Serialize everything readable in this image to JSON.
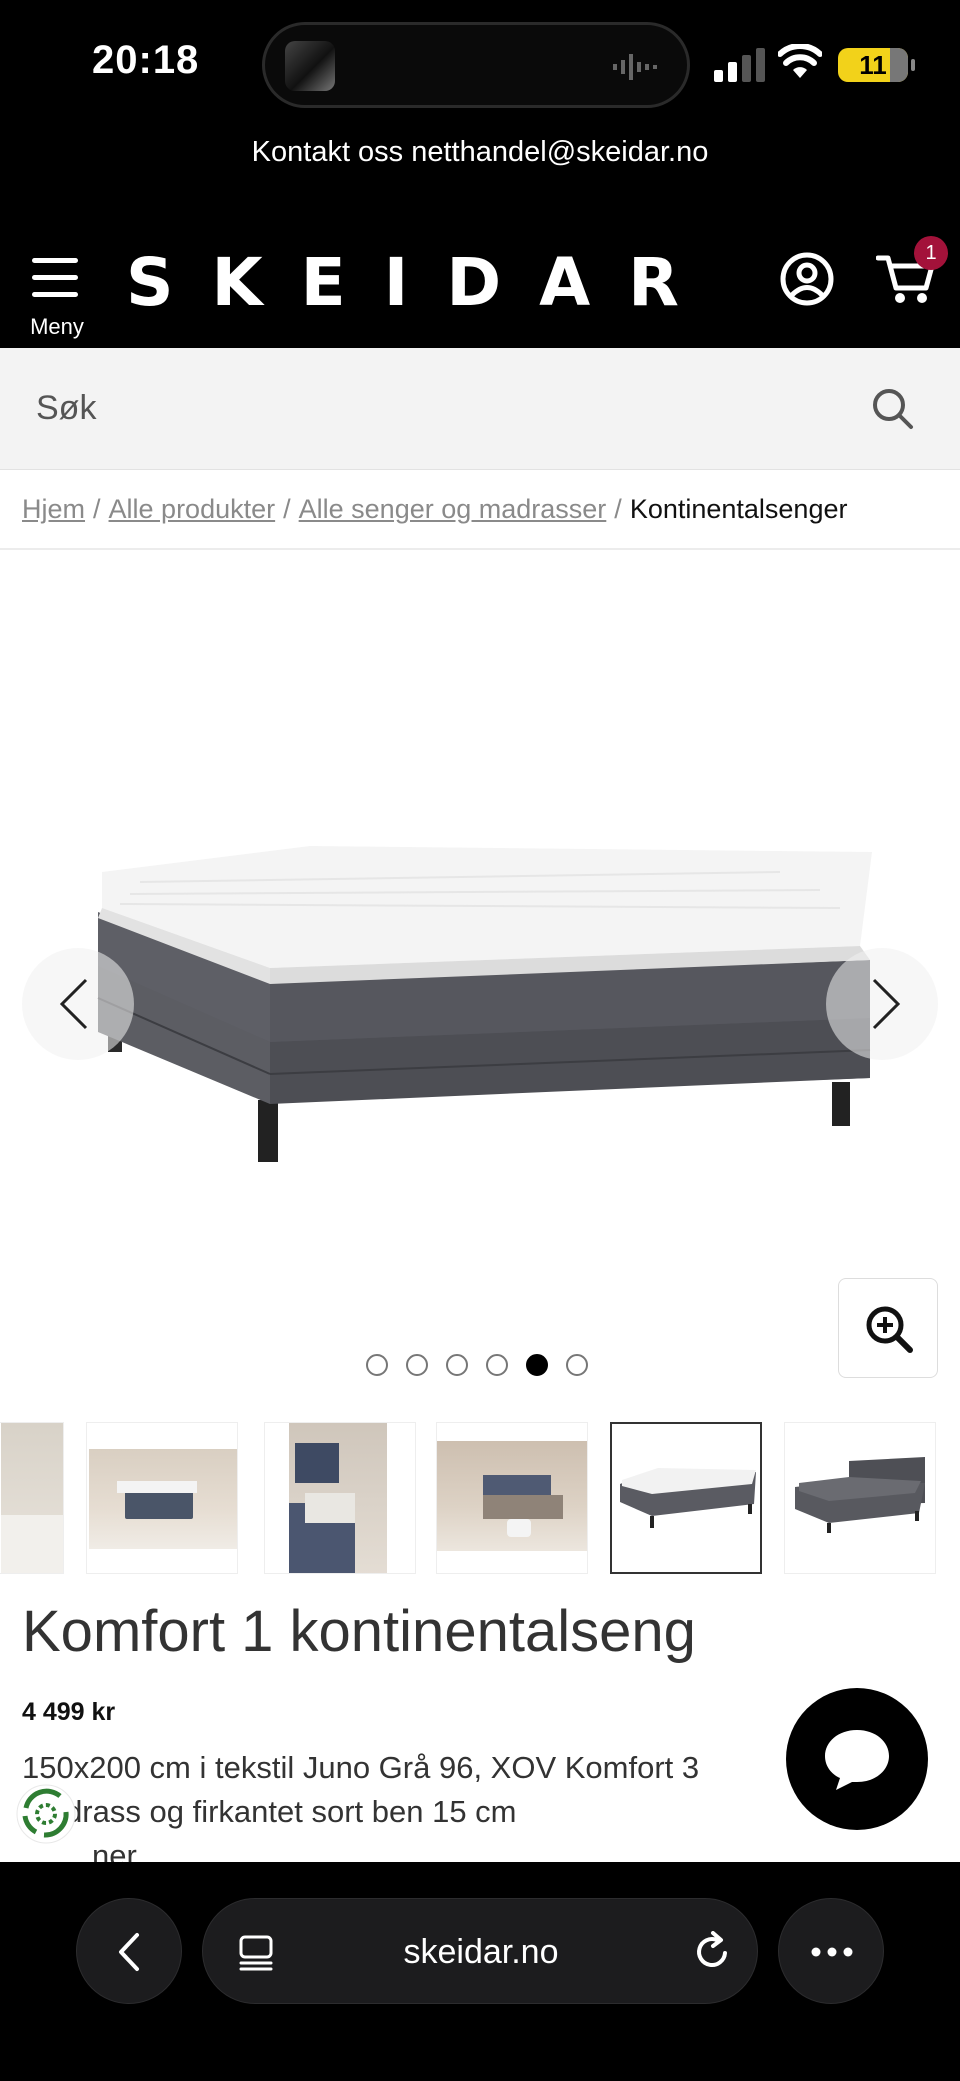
{
  "status": {
    "time": "20:18",
    "battery": "11"
  },
  "contact": {
    "text": "Kontakt oss netthandel@skeidar.no"
  },
  "header": {
    "menu_label": "Meny",
    "logo": "SKEIDAR",
    "cart_count": "1"
  },
  "search": {
    "placeholder": "Søk"
  },
  "breadcrumb": {
    "items": [
      "Hjem",
      "Alle produkter",
      "Alle senger og madrasser"
    ],
    "current": "Kontinentalsenger",
    "separator": "/"
  },
  "gallery": {
    "image_count": 6,
    "active_index": 4
  },
  "product": {
    "title": "Komfort 1 kontinentalseng",
    "price": "4 499 kr",
    "description": "150x200 cm i tekstil Juno Grå 96, XOV Komfort 3 madrass og firkantet sort ben 15 cm",
    "description_tail": "ner"
  },
  "browser": {
    "url": "skeidar.no"
  },
  "colors": {
    "brand_black": "#000000",
    "cart_badge": "#a3123a",
    "eco_green": "#2e7d32"
  }
}
